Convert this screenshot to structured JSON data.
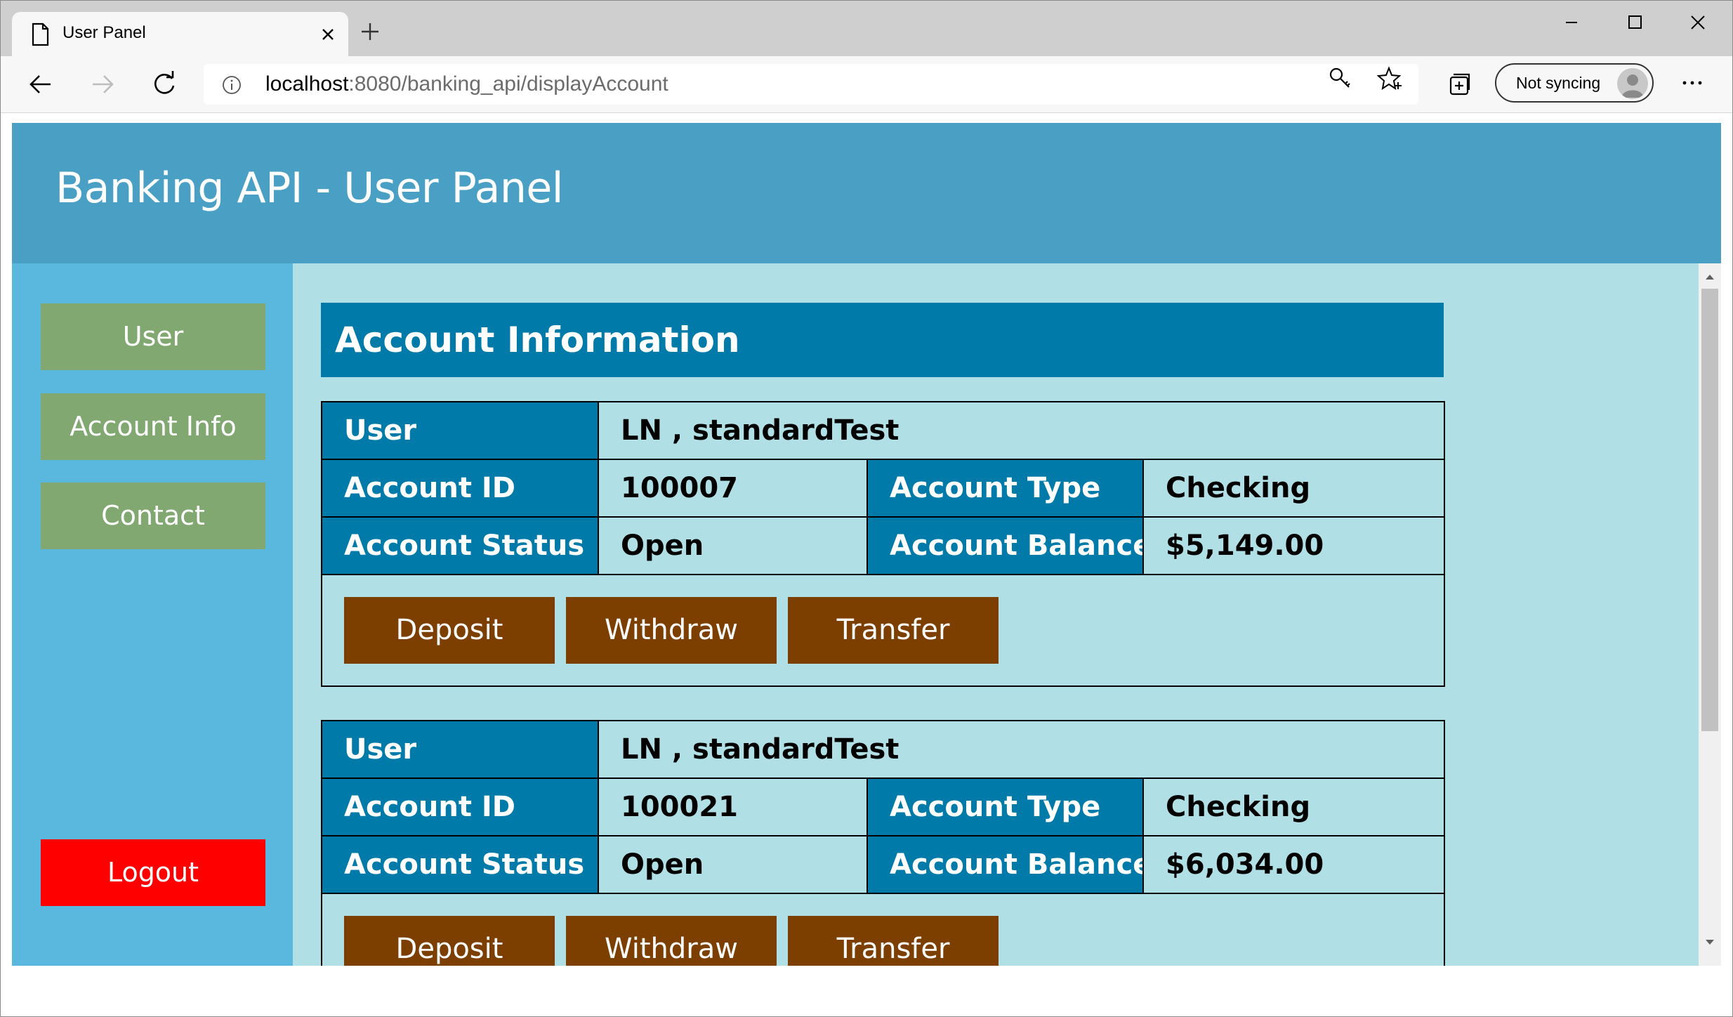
{
  "browser": {
    "tab_title": "User Panel",
    "url_host": "localhost",
    "url_rest": ":8080/banking_api/displayAccount",
    "sync_label": "Not syncing"
  },
  "page": {
    "title": "Banking API - User Panel"
  },
  "sidebar": {
    "items": [
      {
        "label": "User"
      },
      {
        "label": "Account Info"
      },
      {
        "label": "Contact"
      }
    ],
    "logout_label": "Logout"
  },
  "main": {
    "section_title": "Account Information",
    "labels": {
      "user": "User",
      "account_id": "Account ID",
      "account_type": "Account Type",
      "account_status": "Account Status",
      "account_balance": "Account Balance"
    },
    "buttons": {
      "deposit": "Deposit",
      "withdraw": "Withdraw",
      "transfer": "Transfer"
    },
    "accounts": [
      {
        "user": "LN , standardTest",
        "id": "100007",
        "type": "Checking",
        "status": "Open",
        "balance": "$5,149.00"
      },
      {
        "user": "LN , standardTest",
        "id": "100021",
        "type": "Checking",
        "status": "Open",
        "balance": "$6,034.00"
      }
    ]
  },
  "colors": {
    "header_bg": "#4aa0c4",
    "sidebar_bg": "#5ab8de",
    "nav_button": "#80a870",
    "logout_button": "#ff0000",
    "content_bg": "#b0dfe5",
    "label_bg": "#007aa8",
    "action_button": "#7c3f00"
  }
}
